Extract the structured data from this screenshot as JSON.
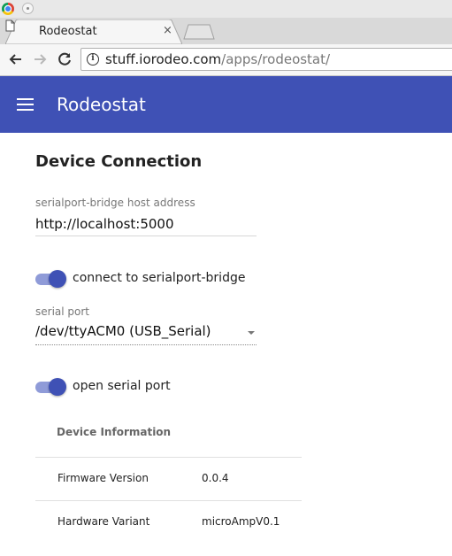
{
  "browser": {
    "tab_title": "Rodeostat",
    "tab_close": "×",
    "url_host": "stuff.iorodeo.com",
    "url_path": "/apps/rodeostat/"
  },
  "appbar": {
    "title": "Rodeostat",
    "color": "#3f51b5"
  },
  "device_connection": {
    "heading": "Device Connection",
    "host_label": "serialport-bridge host address",
    "host_value": "http://localhost:5000",
    "bridge_switch_label": "connect to serialport-bridge",
    "bridge_switch_on": true,
    "port_label": "serial port",
    "port_value": "/dev/ttyACM0 (USB_Serial)",
    "open_switch_label": "open serial port",
    "open_switch_on": true
  },
  "device_information": {
    "header": "Device Information",
    "rows": [
      {
        "key": "Firmware Version",
        "value": "0.0.4"
      },
      {
        "key": "Hardware Variant",
        "value": "microAmpV0.1"
      }
    ]
  },
  "icons": {
    "menu": "hamburger-menu-icon",
    "back": "arrow-left-icon",
    "forward": "arrow-right-icon",
    "reload": "reload-icon",
    "info": "info-icon",
    "page": "page-icon"
  }
}
